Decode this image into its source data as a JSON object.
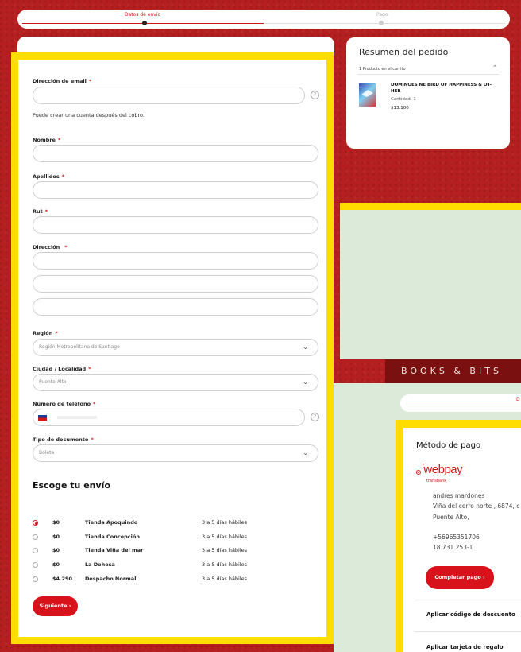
{
  "steps": {
    "step1": "Datos de envío",
    "step2": "Pago"
  },
  "form": {
    "email_label": "Dirección de email",
    "email_hint": "Puede crear una cuenta después del cobro.",
    "nombre_label": "Nombre",
    "apellidos_label": "Apellidos",
    "rut_label": "Rut",
    "direccion_label": "Dirección",
    "region_label": "Región",
    "region_value": "Región Metropolitana de Santiago",
    "ciudad_label": "Ciudad / Localidad",
    "ciudad_value": "Puente Alto",
    "telefono_label": "Número de teléfono",
    "documento_label": "Tipo de documento",
    "documento_value": "Boleta",
    "required_mark": "*",
    "help_mark": "?"
  },
  "shipping": {
    "title": "Escoge tu envío",
    "options": [
      {
        "price": "$0",
        "name": "Tienda Apoquindo",
        "days": "3 a 5 días hábiles",
        "selected": true
      },
      {
        "price": "$0",
        "name": "Tienda Concepción",
        "days": "3 a 5 días hábiles",
        "selected": false
      },
      {
        "price": "$0",
        "name": "Tienda Viña del mar",
        "days": "3 a 5 días hábiles",
        "selected": false
      },
      {
        "price": "$0",
        "name": "La Dehesa",
        "days": "3 a 5 días hábiles",
        "selected": false
      },
      {
        "price": "$4.290",
        "name": "Despacho Normal",
        "days": "3 a 5 días hábiles",
        "selected": false
      }
    ],
    "next_button": "Siguiente"
  },
  "summary": {
    "title": "Resumen del pedido",
    "count": "1 Producto en el carrito",
    "product_name_1": "DOMINOES NE BIRD OF HAPPINESS & OT-",
    "product_name_2": "HER",
    "quantity": "Cantidad: 1",
    "price": "$13.100"
  },
  "payment": {
    "brand": "BOOKS & BITS",
    "step_partial": "D",
    "title": "Método de pago",
    "provider": "webpay",
    "provider_sub": "transbank",
    "customer_name": "andres mardones",
    "address_1": "Viña del cerro norte , 6874, c",
    "address_2": "Puente Alto,",
    "phone": "+56965351706",
    "rut": "18.731.253-1",
    "complete_button": "Completar pago",
    "discount": "Aplicar código de descuento",
    "gift_card": "Aplicar tarjeta de regalo"
  },
  "colors": {
    "accent_red": "#d8121b",
    "highlight_yellow": "#ffdd00",
    "page_red": "#b51f1f"
  }
}
